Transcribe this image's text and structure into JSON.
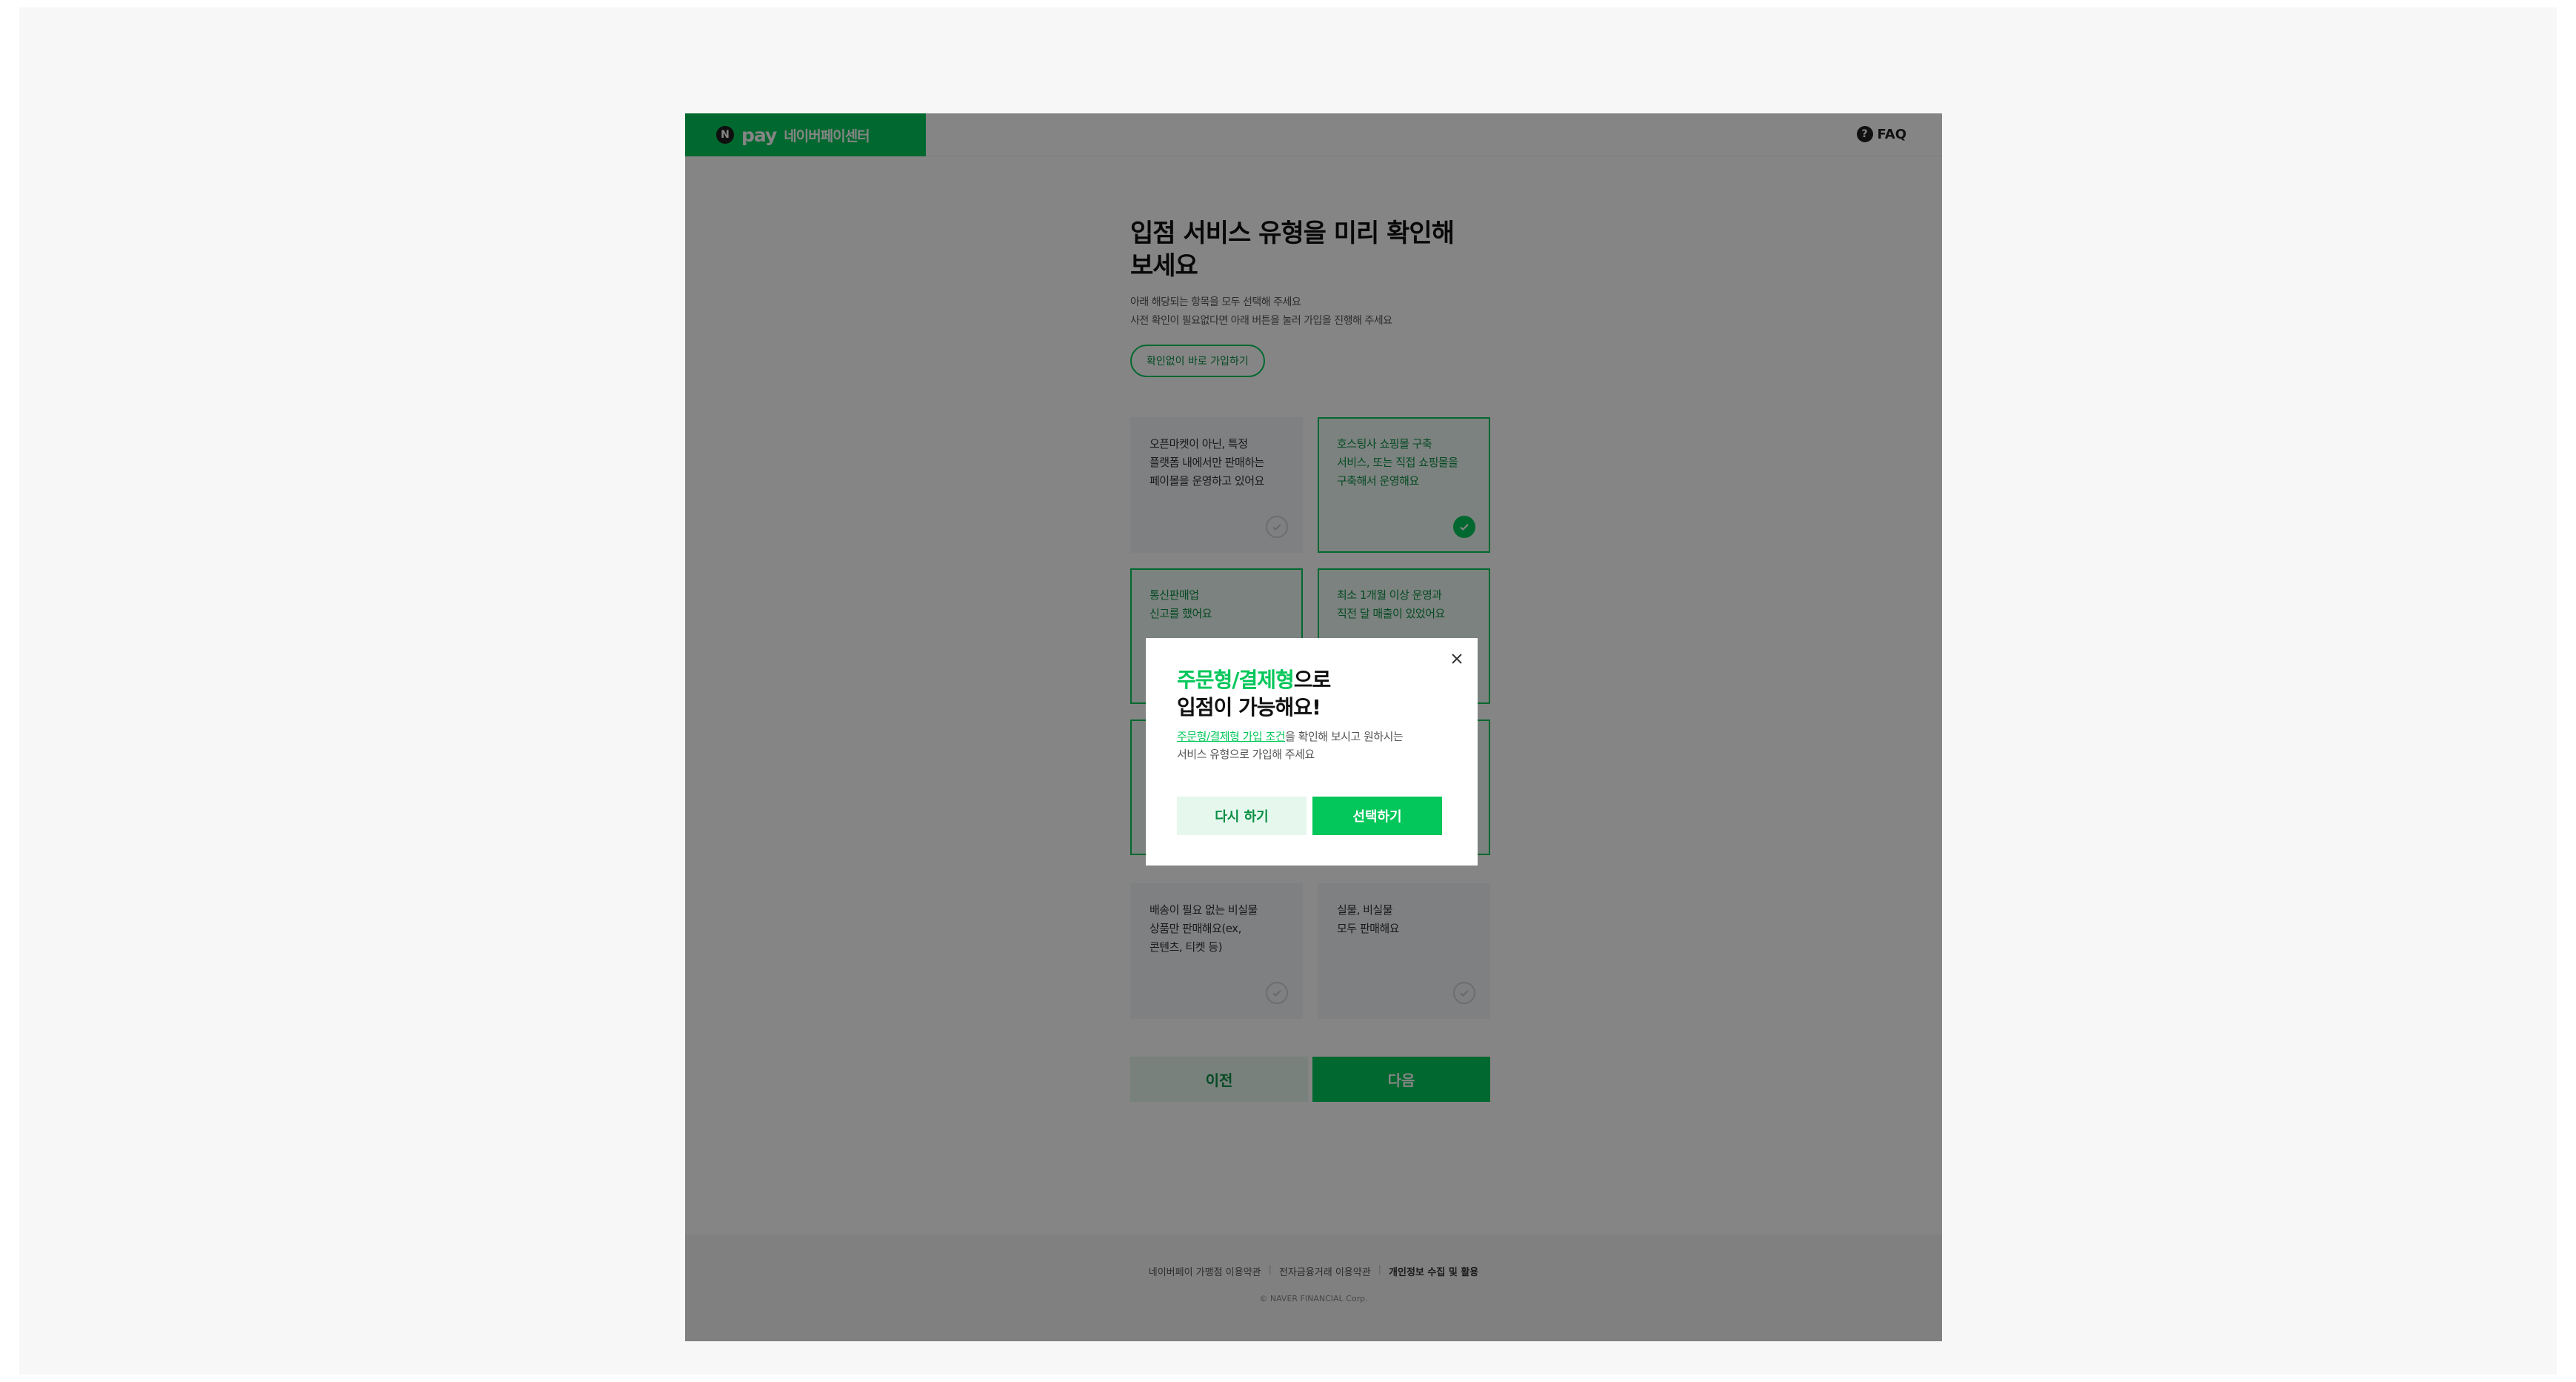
{
  "header": {
    "logo_n": "N",
    "logo_pay": "pay",
    "logo_center": "네이버페이센터",
    "faq_icon": "?",
    "faq_label": "FAQ"
  },
  "main": {
    "title_line1": "입점 서비스 유형을 미리 확인해",
    "title_line2": "보세요",
    "desc_line1": "아래 해당되는 항목을 모두 선택해 주세요",
    "desc_line2": "사전 확인이 필요없다면 아래 버튼을 눌러 가입을 진행해 주세요",
    "skip_button": "확인없이 바로 가입하기",
    "cards": [
      {
        "lines": [
          "오픈마켓이 아닌, 특정",
          "플랫폼 내에서만 판매하는",
          "페이몰을 운영하고 있어요"
        ],
        "selected": false
      },
      {
        "lines": [
          "호스팅사 쇼핑몰 구축",
          "서비스, 또는 직접 쇼핑몰을",
          "구축해서 운영해요"
        ],
        "selected": true
      },
      {
        "lines": [
          "통신판매업",
          "신고를 했어요"
        ],
        "selected": true
      },
      {
        "lines": [
          "최소 1개월 이상 운영과",
          "직전 달 매출이 있었어요"
        ],
        "selected": true
      },
      {
        "lines": [],
        "selected": true
      },
      {
        "lines": [],
        "selected": true
      },
      {
        "lines": [
          "배송이 필요 없는 비실물",
          "상품만 판매해요(ex,",
          "콘텐츠, 티켓 등)"
        ],
        "selected": false
      },
      {
        "lines": [
          "실물, 비실물",
          "모두 판매해요"
        ],
        "selected": false
      }
    ],
    "prev_button": "이전",
    "next_button": "다음"
  },
  "footer": {
    "link1": "네이버페이 가맹점 이용약관",
    "link2": "전자금융거래 이용약관",
    "link3": "개인정보 수집 및 활용",
    "copyright": "© NAVER FINANCIAL Corp."
  },
  "modal": {
    "title_highlight": "주문형/결제형",
    "title_rest": "으로",
    "title_line2": "입점이 가능해요!",
    "desc_link": "주문형/결제형 가입 조건",
    "desc_rest": "을 확인해 보시고 원하시는",
    "desc_line2": "서비스 유형으로 가입해 주세요",
    "retry_button": "다시 하기",
    "select_button": "선택하기"
  },
  "colors": {
    "brand": "#03c75a",
    "overlay": "rgba(0,0,0,0.48)"
  }
}
